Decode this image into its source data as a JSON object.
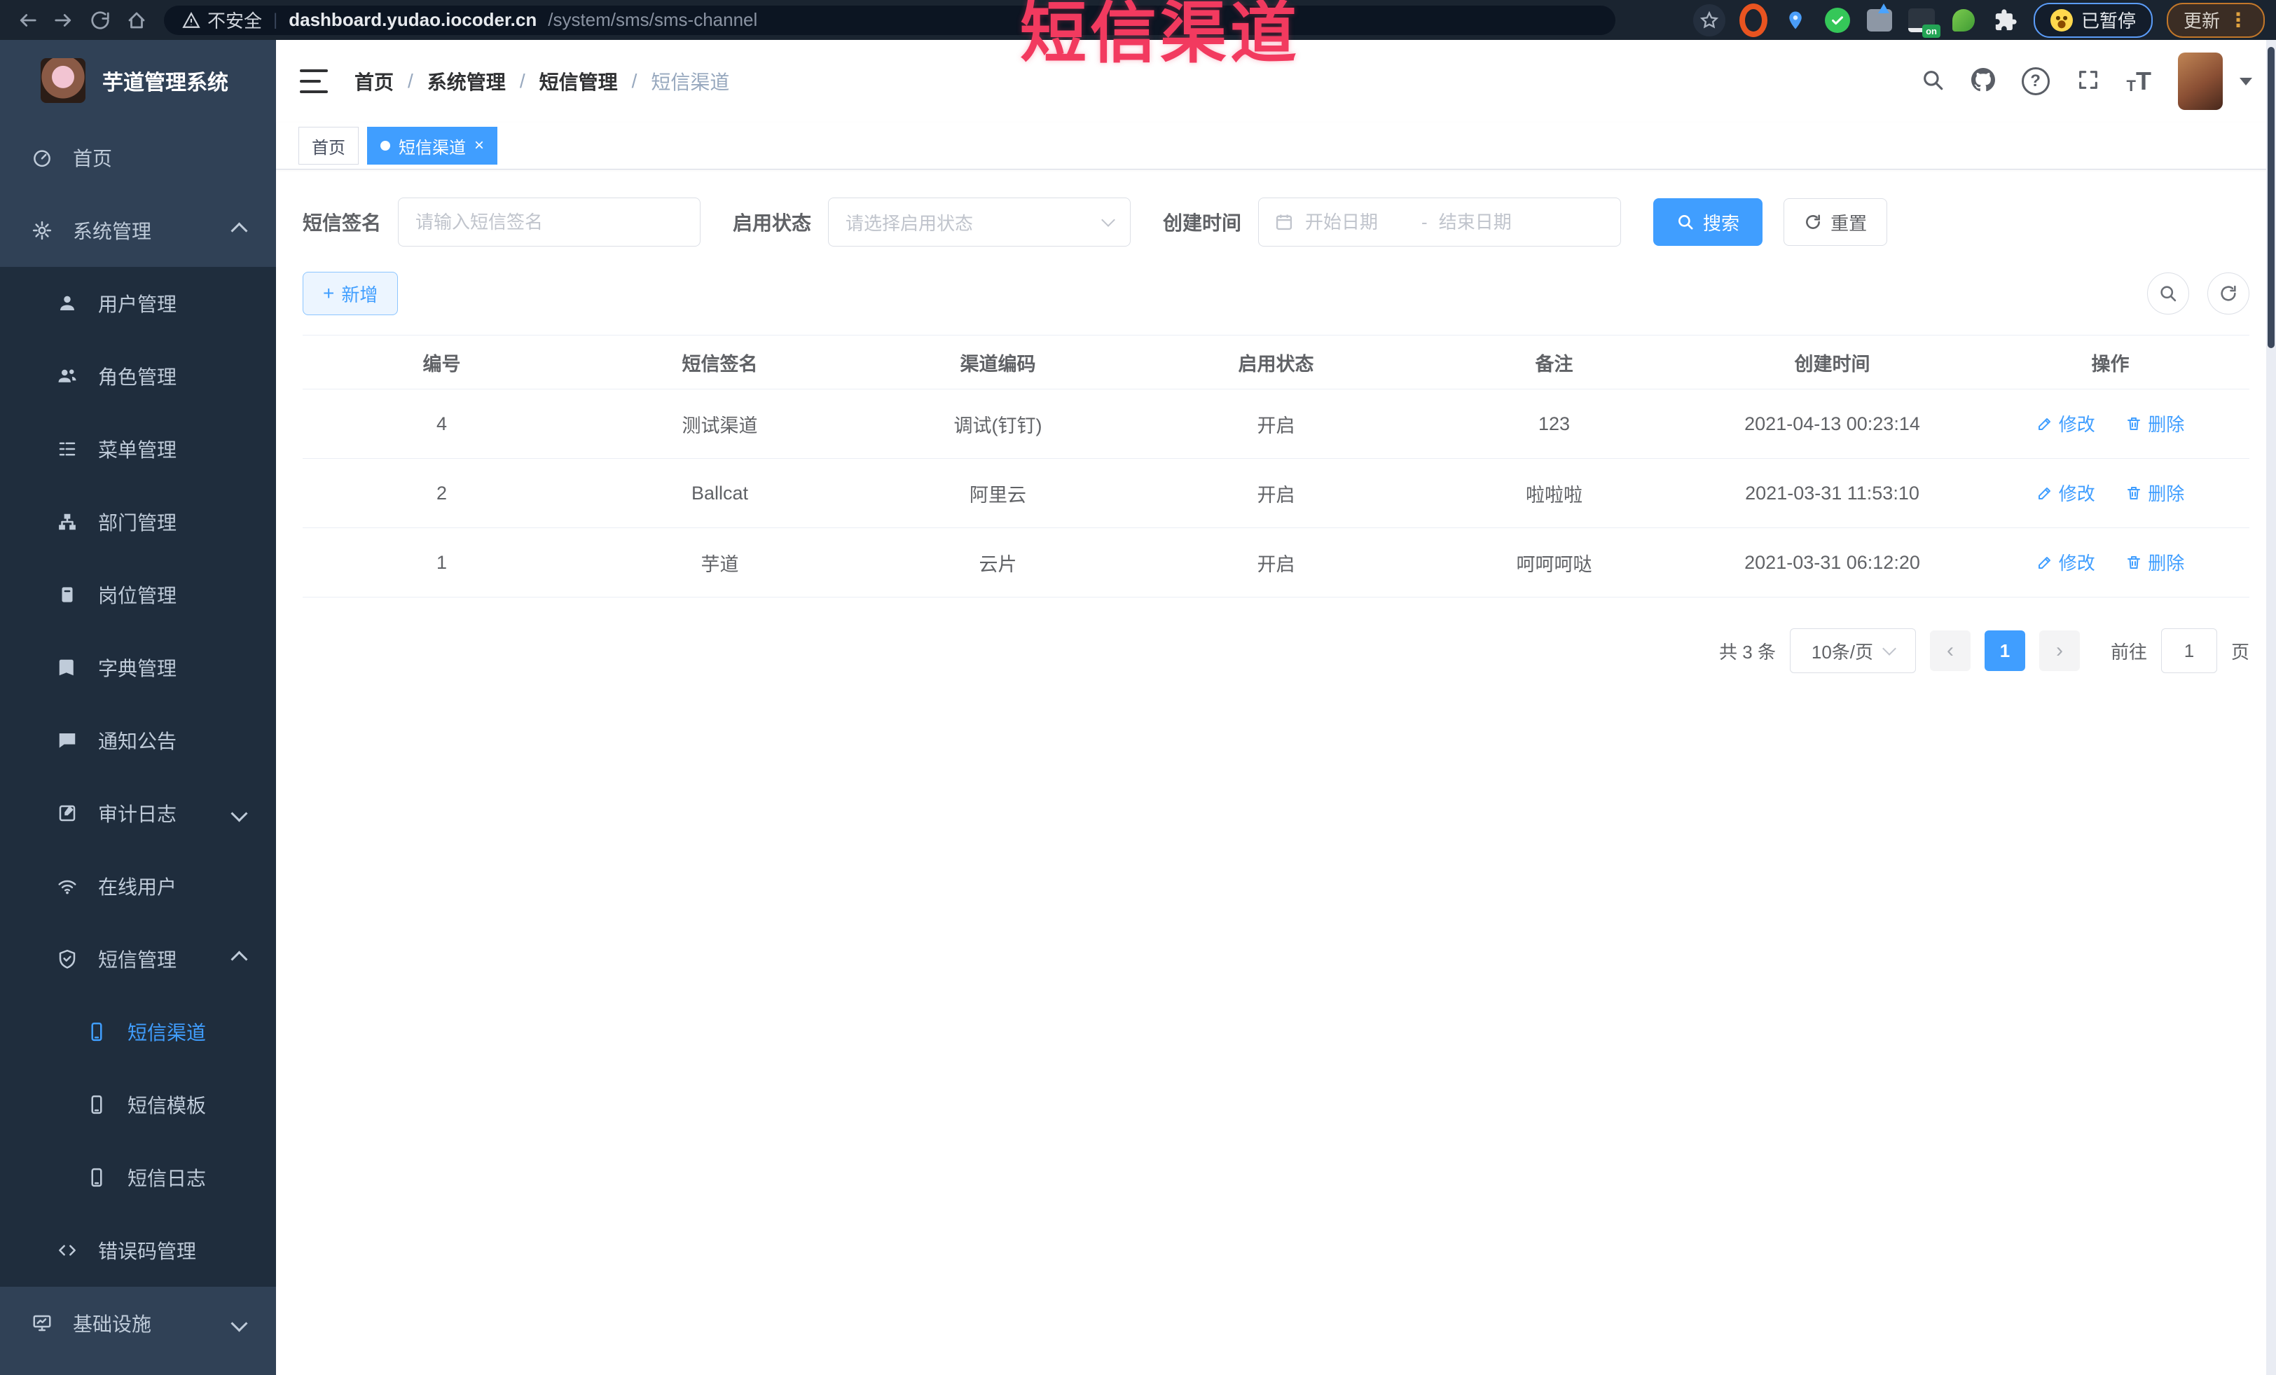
{
  "browser": {
    "security_label": "不安全",
    "url_host": "dashboard.yudao.iocoder.cn",
    "url_path": "/system/sms/sms-channel",
    "paused_label": "已暂停",
    "update_label": "更新"
  },
  "overlay_title": "短信渠道",
  "sidebar": {
    "logo_title": "芋道管理系统",
    "items": [
      {
        "label": "首页"
      },
      {
        "label": "系统管理"
      },
      {
        "label": "用户管理"
      },
      {
        "label": "角色管理"
      },
      {
        "label": "菜单管理"
      },
      {
        "label": "部门管理"
      },
      {
        "label": "岗位管理"
      },
      {
        "label": "字典管理"
      },
      {
        "label": "通知公告"
      },
      {
        "label": "审计日志"
      },
      {
        "label": "在线用户"
      },
      {
        "label": "短信管理"
      },
      {
        "label": "短信渠道"
      },
      {
        "label": "短信模板"
      },
      {
        "label": "短信日志"
      },
      {
        "label": "错误码管理"
      },
      {
        "label": "基础设施"
      }
    ]
  },
  "breadcrumb": [
    "首页",
    "系统管理",
    "短信管理",
    "短信渠道"
  ],
  "tabs": [
    {
      "label": "首页"
    },
    {
      "label": "短信渠道"
    }
  ],
  "filters": {
    "sign_label": "短信签名",
    "sign_placeholder": "请输入短信签名",
    "status_label": "启用状态",
    "status_placeholder": "请选择启用状态",
    "time_label": "创建时间",
    "date_start_placeholder": "开始日期",
    "date_separator": "-",
    "date_end_placeholder": "结束日期",
    "search_label": "搜索",
    "reset_label": "重置"
  },
  "toolbar": {
    "add_label": "新增"
  },
  "table": {
    "headers": [
      "编号",
      "短信签名",
      "渠道编码",
      "启用状态",
      "备注",
      "创建时间",
      "操作"
    ],
    "edit_label": "修改",
    "delete_label": "删除",
    "rows": [
      {
        "id": "4",
        "sign": "测试渠道",
        "code": "调试(钉钉)",
        "status": "开启",
        "remark": "123",
        "created": "2021-04-13 00:23:14"
      },
      {
        "id": "2",
        "sign": "Ballcat",
        "code": "阿里云",
        "status": "开启",
        "remark": "啦啦啦",
        "created": "2021-03-31 11:53:10"
      },
      {
        "id": "1",
        "sign": "芋道",
        "code": "云片",
        "status": "开启",
        "remark": "呵呵呵哒",
        "created": "2021-03-31 06:12:20"
      }
    ]
  },
  "pagination": {
    "total_label": "共 3 条",
    "page_size_label": "10条/页",
    "current_page": "1",
    "goto_label": "前往",
    "goto_value": "1",
    "page_unit": "页"
  },
  "colors": {
    "accent": "#409eff",
    "overlay_title": "#f23a5f",
    "sidebar_bg": "#304156",
    "sidebar_submenu_bg": "#1f2d3d",
    "browser_bar_bg": "#1a2430"
  }
}
